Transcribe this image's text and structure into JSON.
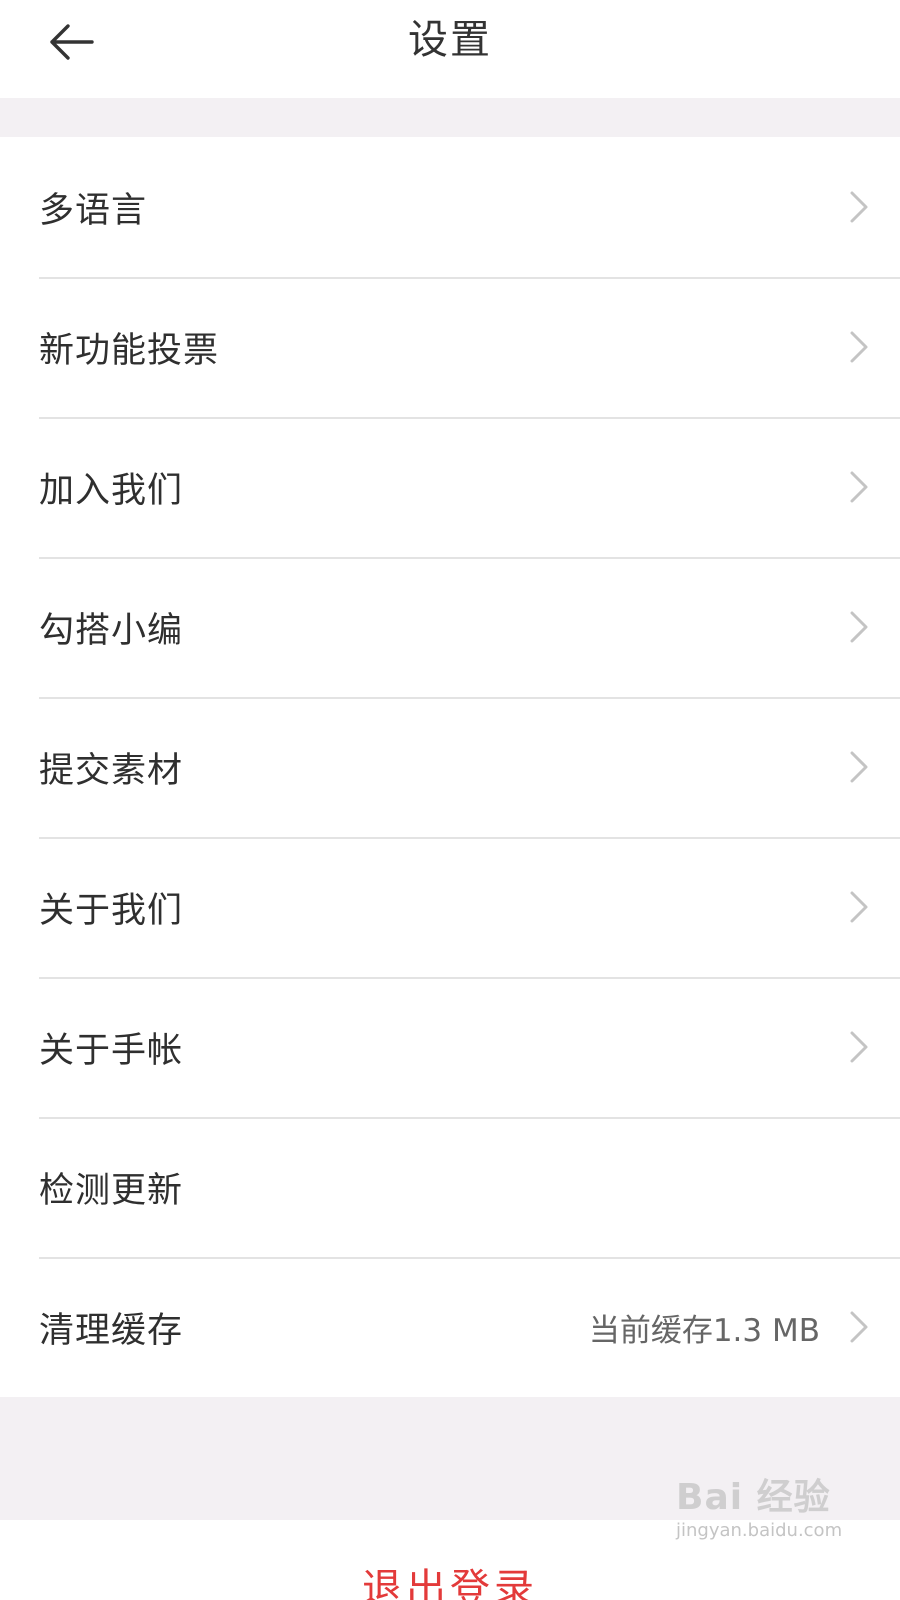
{
  "header": {
    "title": "设置",
    "back_icon": "arrow-left-icon"
  },
  "menu": {
    "items": [
      {
        "label": "多语言",
        "value": "",
        "chevron": true
      },
      {
        "label": "新功能投票",
        "value": "",
        "chevron": true
      },
      {
        "label": "加入我们",
        "value": "",
        "chevron": true
      },
      {
        "label": "勾搭小编",
        "value": "",
        "chevron": true
      },
      {
        "label": "提交素材",
        "value": "",
        "chevron": true
      },
      {
        "label": "关于我们",
        "value": "",
        "chevron": true
      },
      {
        "label": "关于手帐",
        "value": "",
        "chevron": true
      },
      {
        "label": "检测更新",
        "value": "",
        "chevron": false
      },
      {
        "label": "清理缓存",
        "value": "当前缓存1.3 MB",
        "chevron": true
      }
    ]
  },
  "logout": {
    "label": "退出登录"
  },
  "watermark": {
    "brand": "Bai 经验",
    "url": "jingyan.baidu.com"
  },
  "colors": {
    "background": "#f3f0f3",
    "surface": "#ffffff",
    "text": "#2f2f2f",
    "secondary_text": "#666666",
    "chevron": "#c4c4c4",
    "divider": "#e3e3e3",
    "danger": "#e33a3a"
  }
}
